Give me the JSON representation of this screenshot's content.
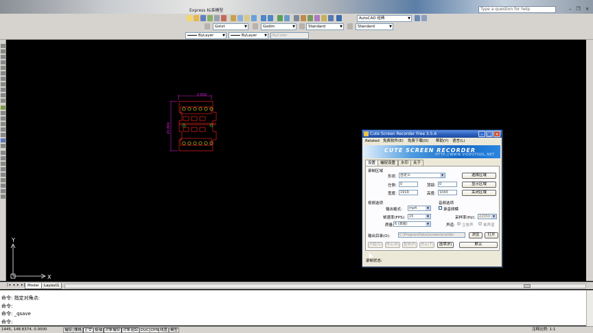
{
  "app": {
    "title": "Express   标准模型",
    "help_placeholder": "Type a question for help"
  },
  "toolbar": {
    "workspace": "AutoCAD 经典",
    "text_style": "Gstxt",
    "dim_style": "Gsdim",
    "table_style": "Standard",
    "multileader_style": "Standard",
    "color": "ByLayer",
    "linetype": "ByLayer",
    "lineweight": "ByColor"
  },
  "drawing": {
    "dim_top": "0.850",
    "dim_left": "20.800",
    "ucs_y": "Y",
    "ucs_x": "X"
  },
  "tabs": {
    "model": "Model",
    "layout1": "Layout1"
  },
  "command": {
    "lines": [
      "命令: 指定对角点:",
      "命令:",
      "命令: _qsave",
      "命令:"
    ]
  },
  "status": {
    "coords": "1445, 148.8374, 0.0000",
    "buttons": [
      "捕捉",
      "栅格",
      "正交",
      "极轴",
      "对象捕捉",
      "对象追踪",
      "DUCS",
      "DYN",
      "线宽",
      "模型"
    ],
    "on": [
      false,
      false,
      true,
      false,
      true,
      true,
      false,
      false,
      false,
      false
    ],
    "scale": "注释比例: 1:1"
  },
  "dialog": {
    "title": "Cute Screen Recorder Free 3.5.6",
    "menu": [
      "Related",
      "免费软件(E)",
      "免费下载(D)",
      "帮助(Y)",
      "语言(L)"
    ],
    "banner_title": "CUTE SCREEN RECORDER",
    "banner_url": "HTTP://WWW.VIDEOTOOL.NET",
    "tabs": [
      "设置",
      "捕捉设置",
      "水印",
      "关于"
    ],
    "area_section": "录制区域",
    "shape_label": "形状:",
    "shape_value": "自定义",
    "left_label": "左侧:",
    "left_value": "0",
    "top_label": "顶部:",
    "top_value": "0",
    "width_label": "宽度:",
    "width_value": "1919",
    "height_label": "高度:",
    "height_value": "1043",
    "select_area": "选择区域",
    "show_area": "显示区域",
    "hide_area": "关闭区域",
    "video_section": "视频选项",
    "audio_section": "音频选项",
    "format_label": "输出格式:",
    "format_value": "mp4",
    "record_audio": "录音频模",
    "fps_label": "帧速率(FPS):",
    "fps_value": "15",
    "sample_label": "采样率(Hz):",
    "sample_value": "22050",
    "quality_label": "质量:",
    "quality_value": "6 (高级)",
    "channel_label": "声道:",
    "stereo": "立体声",
    "mono": "单声道",
    "output_label": "输出目录(O):",
    "output_value": "C:\\ProgramData\\screenrecorder",
    "browse": "浏览",
    "open": "打开",
    "btn_start": "开始(S)",
    "btn_stop": "停止(R)",
    "btn_pause": "暂停(P)",
    "btn_end": "停止(T)",
    "btn_options": "选项(E)",
    "btn_default": "默认",
    "status_label": "录制状态:"
  }
}
